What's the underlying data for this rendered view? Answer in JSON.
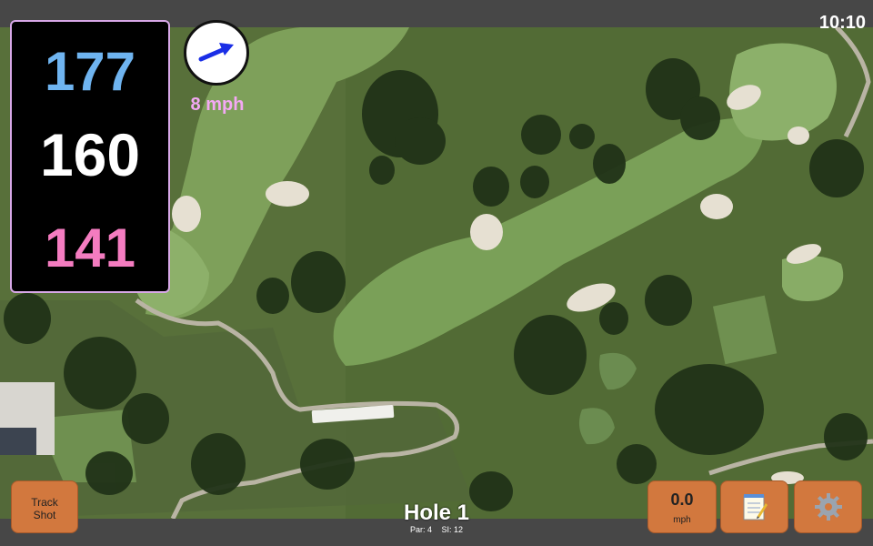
{
  "status": {
    "time": "10:10"
  },
  "distances": {
    "back": "177",
    "center": "160",
    "front": "141",
    "colors": {
      "back": "#6fb4f0",
      "center": "#ffffff",
      "front": "#f47cc0"
    }
  },
  "wind": {
    "speed_label": "8 mph",
    "arrow_color": "#1a2ee6",
    "label_color": "#f4a8f4"
  },
  "hole": {
    "title": "Hole 1",
    "par": "Par: 4",
    "si": "SI: 12"
  },
  "buttons": {
    "track_shot_line1": "Track",
    "track_shot_line2": "Shot",
    "wind_value": "0.0",
    "wind_unit": "mph",
    "notes_icon": "notepad-icon",
    "settings_icon": "gear-icon",
    "color": "#d2783e"
  },
  "map": {
    "type": "aerial-satellite-golf-hole"
  }
}
